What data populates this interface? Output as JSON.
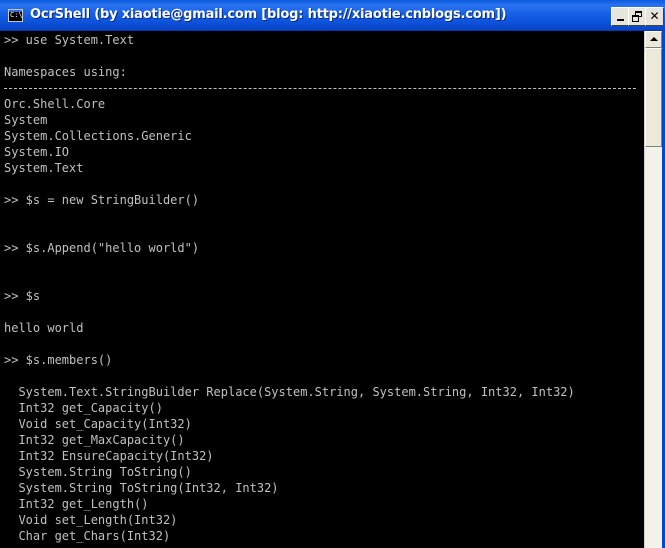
{
  "window": {
    "title": "OcrShell (by xiaotie@gmail.com [blog: http://xiaotie.cnblogs.com])",
    "icon_text": "C:\\",
    "icon": "console-window-icon",
    "buttons": {
      "minimize_icon": "minimize-icon",
      "maximize_icon": "restore-icon",
      "close_label": "✕"
    },
    "colors": {
      "titlebar": "#1760e8",
      "console_bg": "#000000",
      "console_text": "#c0c0c0"
    }
  },
  "console": {
    "separator": "----------------------------------------------------------------------------------",
    "lines": [
      ">> use System.Text",
      "Namespaces using:",
      "Orc.Shell.Core",
      "System",
      "System.Collections.Generic",
      "System.IO",
      "System.Text",
      ">> $s = new StringBuilder()",
      ">> $s.Append(\"hello world\")",
      ">> $s",
      "hello world",
      ">> $s.members()",
      "  System.Text.StringBuilder Replace(System.String, System.String, Int32, Int32)",
      "  Int32 get_Capacity()",
      "  Void set_Capacity(Int32)",
      "  Int32 get_MaxCapacity()",
      "  Int32 EnsureCapacity(Int32)",
      "  System.String ToString()",
      "  System.String ToString(Int32, Int32)",
      "  Int32 get_Length()",
      "  Void set_Length(Int32)",
      "  Char get_Chars(Int32)"
    ]
  },
  "scrollbar": {
    "up_icon": "scroll-up-arrow-icon"
  }
}
